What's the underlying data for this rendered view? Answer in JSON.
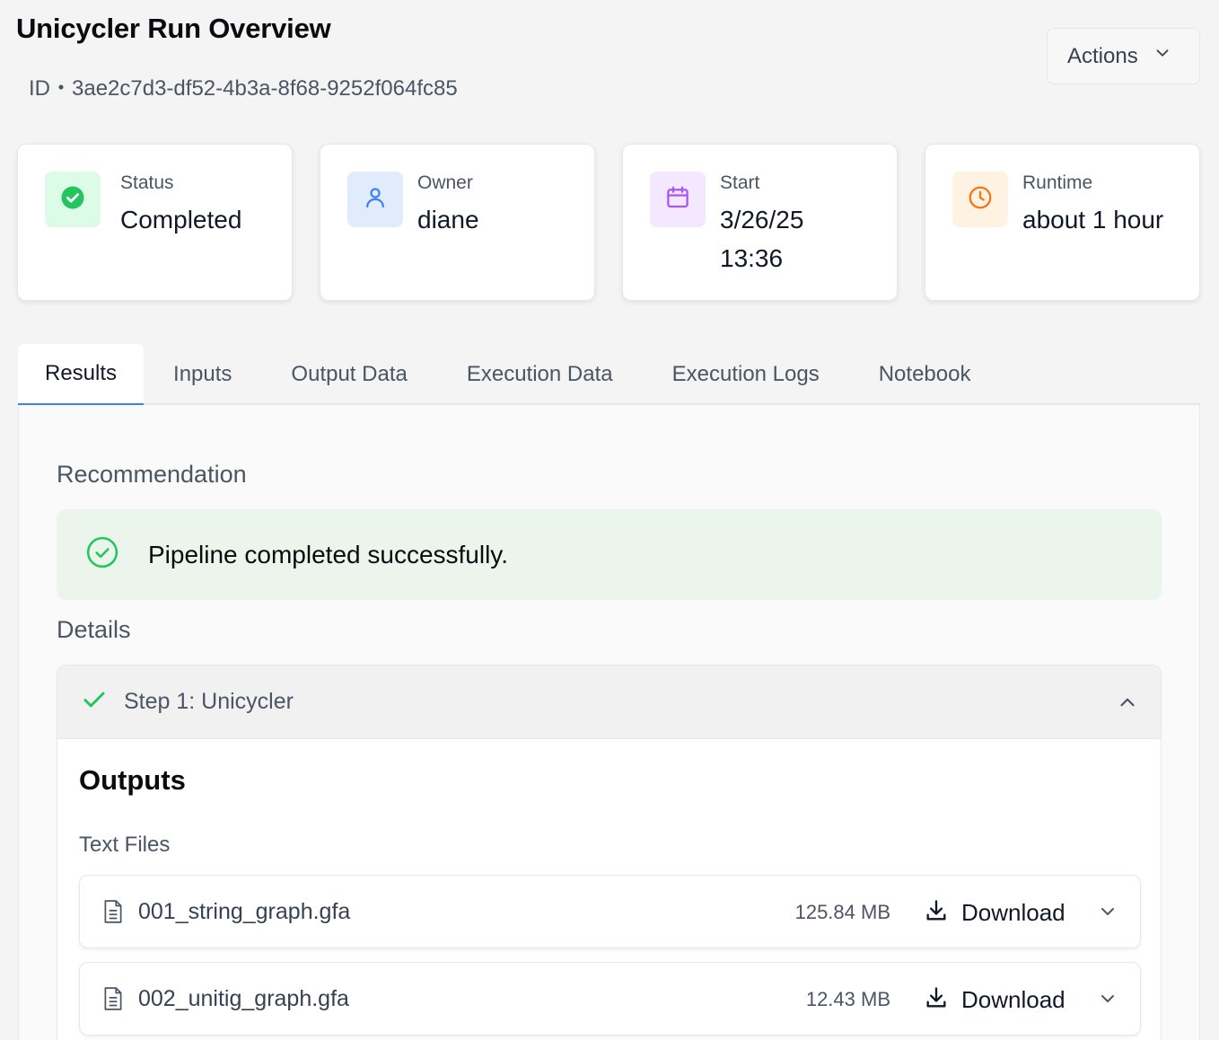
{
  "header": {
    "title": "Unicycler Run Overview",
    "id_text": "ID・3ae2c7d3-df52-4b3a-8f68-9252f064fc85",
    "actions_label": "Actions"
  },
  "cards": [
    {
      "label": "Status",
      "value": "Completed",
      "icon": "check-circle-icon",
      "accent": "#22c55e",
      "bg": "#dcfce7"
    },
    {
      "label": "Owner",
      "value": "diane",
      "icon": "user-icon",
      "accent": "#3b82f6",
      "bg": "#e0ecfc"
    },
    {
      "label": "Start",
      "value": "3/26/25 13:36",
      "icon": "calendar-icon",
      "accent": "#a855f7",
      "bg": "#f3e8ff"
    },
    {
      "label": "Runtime",
      "value": "about 1 hour",
      "icon": "clock-icon",
      "accent": "#f97316",
      "bg": "#fef3e2"
    }
  ],
  "tabs": [
    "Results",
    "Inputs",
    "Output Data",
    "Execution Data",
    "Execution Logs",
    "Notebook"
  ],
  "active_tab": "Results",
  "results": {
    "recommendation_heading": "Recommendation",
    "recommendation_text": "Pipeline completed successfully.",
    "details_heading": "Details",
    "step_title": "Step 1: Unicycler",
    "outputs_heading": "Outputs",
    "text_files_heading": "Text Files",
    "files": [
      {
        "name": "001_string_graph.gfa",
        "size": "125.84 MB",
        "download_label": "Download"
      },
      {
        "name": "002_unitig_graph.gfa",
        "size": "12.43 MB",
        "download_label": "Download"
      }
    ]
  },
  "colors": {
    "success": "#22c55e",
    "active_tab_underline": "#3b82f6",
    "recommendation_bg": "#ecf5ec"
  }
}
